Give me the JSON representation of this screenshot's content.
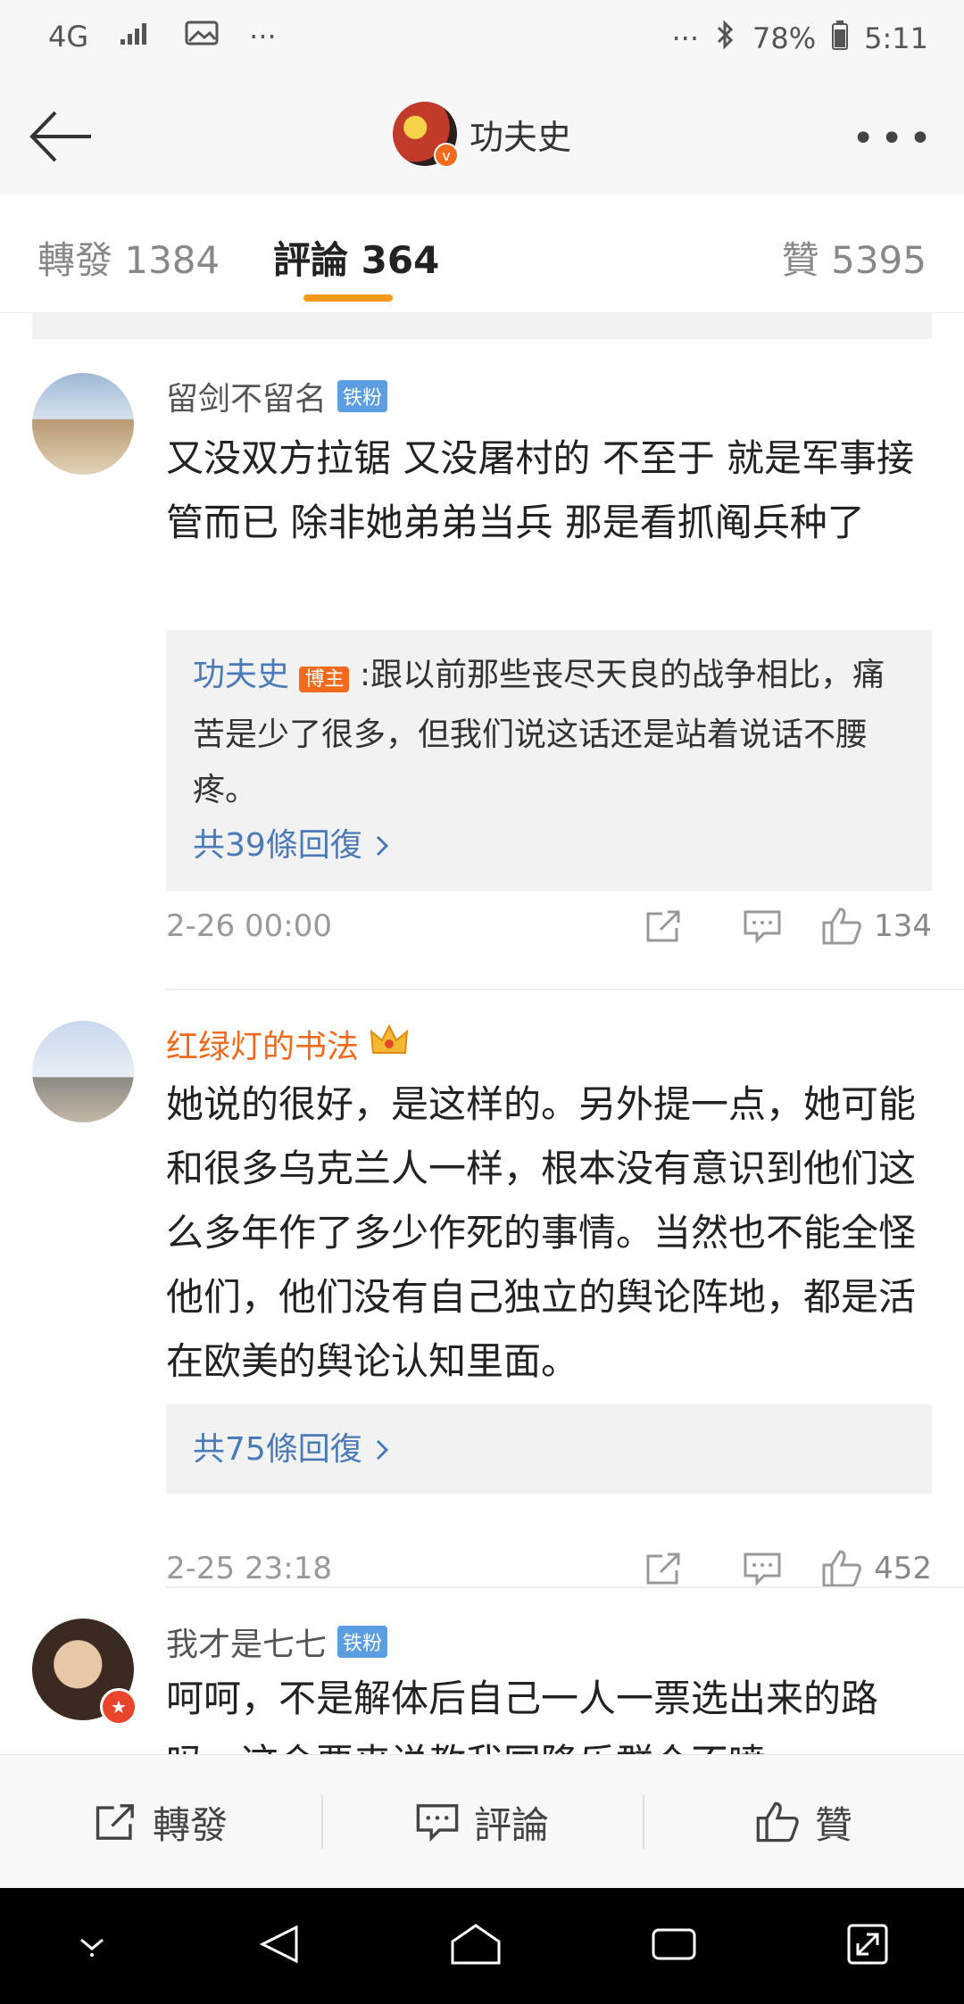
{
  "status": {
    "network": "4G",
    "battery": "78%",
    "time": "5:11",
    "more": "···"
  },
  "nav": {
    "title": "功夫史",
    "more": "•••"
  },
  "tabs": [
    {
      "label": "轉發 1384"
    },
    {
      "label": "評論 364"
    },
    {
      "label": "贊 5395"
    }
  ],
  "comments": [
    {
      "name": "留剑不留名",
      "badge": "铁粉",
      "text": "又没双方拉锯 又没屠村的 不至于 就是军事接管而已 除非她弟弟当兵 那是看抓阄兵种了",
      "reply_author": "功夫史",
      "reply_badge": "博主",
      "reply_text": ":跟以前那些丧尽天良的战争相比，痛苦是少了很多，但我们说这话还是站着说话不腰疼。",
      "reply_more": "共39條回復",
      "time": "2-26 00:00",
      "likes": "134"
    },
    {
      "name": "红绿灯的书法",
      "text": "她说的很好，是这样的。另外提一点，她可能和很多乌克兰人一样，根本没有意识到他们这么多年作了多少作死的事情。当然也不能全怪他们，他们没有自己独立的舆论阵地，都是活在欧美的舆论认知里面。",
      "reply_more": "共75條回復",
      "time": "2-25 23:18",
      "likes": "452"
    },
    {
      "name": "我才是七七",
      "badge": "铁粉",
      "text": "呵呵，不是解体后自己一人一票选出来的路吗，这会要来说教我国降乐群众不喷"
    }
  ],
  "bottom": {
    "repost": "轉發",
    "comment": "評論",
    "like": "贊"
  },
  "colors": {
    "accent": "#f39a1b",
    "link": "#4a7ab8",
    "badge_fan": "#5a9de0",
    "badge_owner": "#f26a1b"
  }
}
